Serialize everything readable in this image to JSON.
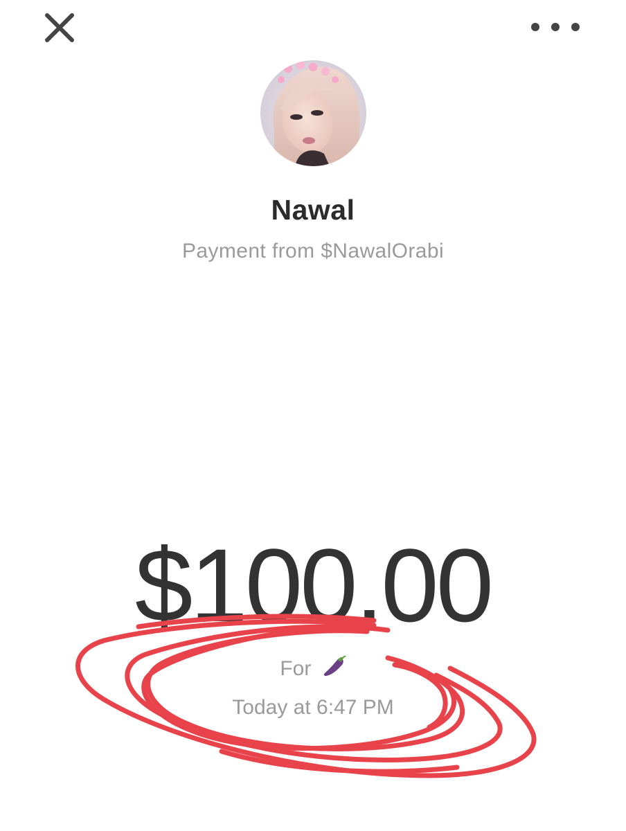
{
  "header": {
    "close_icon": "close-icon",
    "more_icon": "more-horizontal-icon"
  },
  "profile": {
    "avatar_icon": "profile-photo",
    "name": "Nawal",
    "subtitle": "Payment from $NawalOrabi"
  },
  "payment": {
    "amount": "$100.00",
    "note_prefix": "For",
    "note_emoji": "eggplant-emoji",
    "timestamp": "Today at 6:47 PM"
  },
  "annotation": {
    "color": "#e8434a"
  },
  "colors": {
    "background": "#ffffff",
    "primary_text": "#2b2b2b",
    "secondary_text": "#9a9a9a",
    "icon": "#444444"
  }
}
